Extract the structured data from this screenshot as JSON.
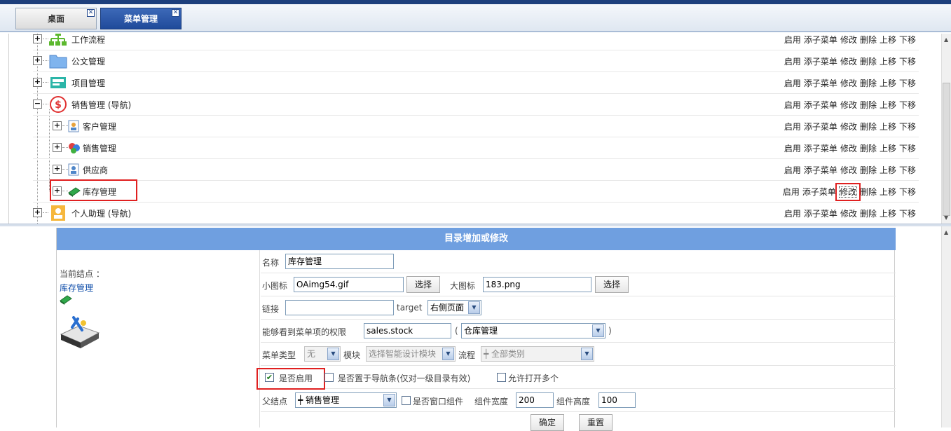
{
  "tabs": [
    {
      "label": "桌面",
      "active": false
    },
    {
      "label": "菜单管理",
      "active": true
    }
  ],
  "tree": {
    "action_labels": [
      "启用",
      "添子菜单",
      "修改",
      "删除",
      "上移",
      "下移"
    ],
    "rows": [
      {
        "label": "工作流程",
        "level": 0,
        "expander": "+",
        "icon": "flowchart-icon"
      },
      {
        "label": "公文管理",
        "level": 0,
        "expander": "+",
        "icon": "folder-icon"
      },
      {
        "label": "项目管理",
        "level": 0,
        "expander": "+",
        "icon": "project-icon"
      },
      {
        "label": "销售管理 (导航)",
        "level": 0,
        "expander": "-",
        "icon": "dollar-icon"
      },
      {
        "label": "客户管理",
        "level": 1,
        "expander": "+",
        "icon": "customer-icon"
      },
      {
        "label": "销售管理",
        "level": 1,
        "expander": "+",
        "icon": "sales-icon"
      },
      {
        "label": "供应商",
        "level": 1,
        "expander": "+",
        "icon": "supplier-icon"
      },
      {
        "label": "库存管理",
        "level": 1,
        "expander": "+",
        "icon": "inventory-icon",
        "highlighted": true
      },
      {
        "label": "个人助理 (导航)",
        "level": 0,
        "expander": "+",
        "icon": "assistant-icon"
      }
    ]
  },
  "form": {
    "title": "目录增加或修改",
    "current_node_label": "当前结点 ：",
    "current_node_value": "库存管理",
    "name_label": "名称",
    "name_value": "库存管理",
    "small_icon_label": "小图标",
    "small_icon_value": "OAimg54.gif",
    "small_icon_button": "选择",
    "large_icon_label": "大图标",
    "large_icon_value": "183.png",
    "large_icon_button": "选择",
    "link_label": "链接",
    "link_value": "",
    "target_label": "target",
    "target_value": "右侧页面",
    "perm_label": "能够看到菜单项的权限",
    "perm_value": "sales.stock",
    "perm_open": "(",
    "perm_select": "仓库管理",
    "perm_close": ")",
    "menu_type_label": "菜单类型",
    "menu_type_value": "无",
    "module_label": "模块",
    "module_value": "选择智能设计模块",
    "flow_label": "流程",
    "flow_value": "┿ 全部类别",
    "enable_label": "是否启用",
    "enable_checked": true,
    "navbar_label": "是否置于导航条(仅对一级目录有效)",
    "multi_open_label": "允许打开多个",
    "parent_label": "父结点",
    "parent_value": "┿ 销售管理",
    "window_comp_label": "是否窗口组件",
    "comp_width_label": "组件宽度",
    "comp_width_value": "200",
    "comp_height_label": "组件高度",
    "comp_height_value": "100",
    "ok_button": "确定",
    "reset_button": "重置"
  },
  "colors": {
    "header_blue": "#6f9fe0",
    "active_tab": "#1f4a9a",
    "highlight_red": "#e02020"
  }
}
